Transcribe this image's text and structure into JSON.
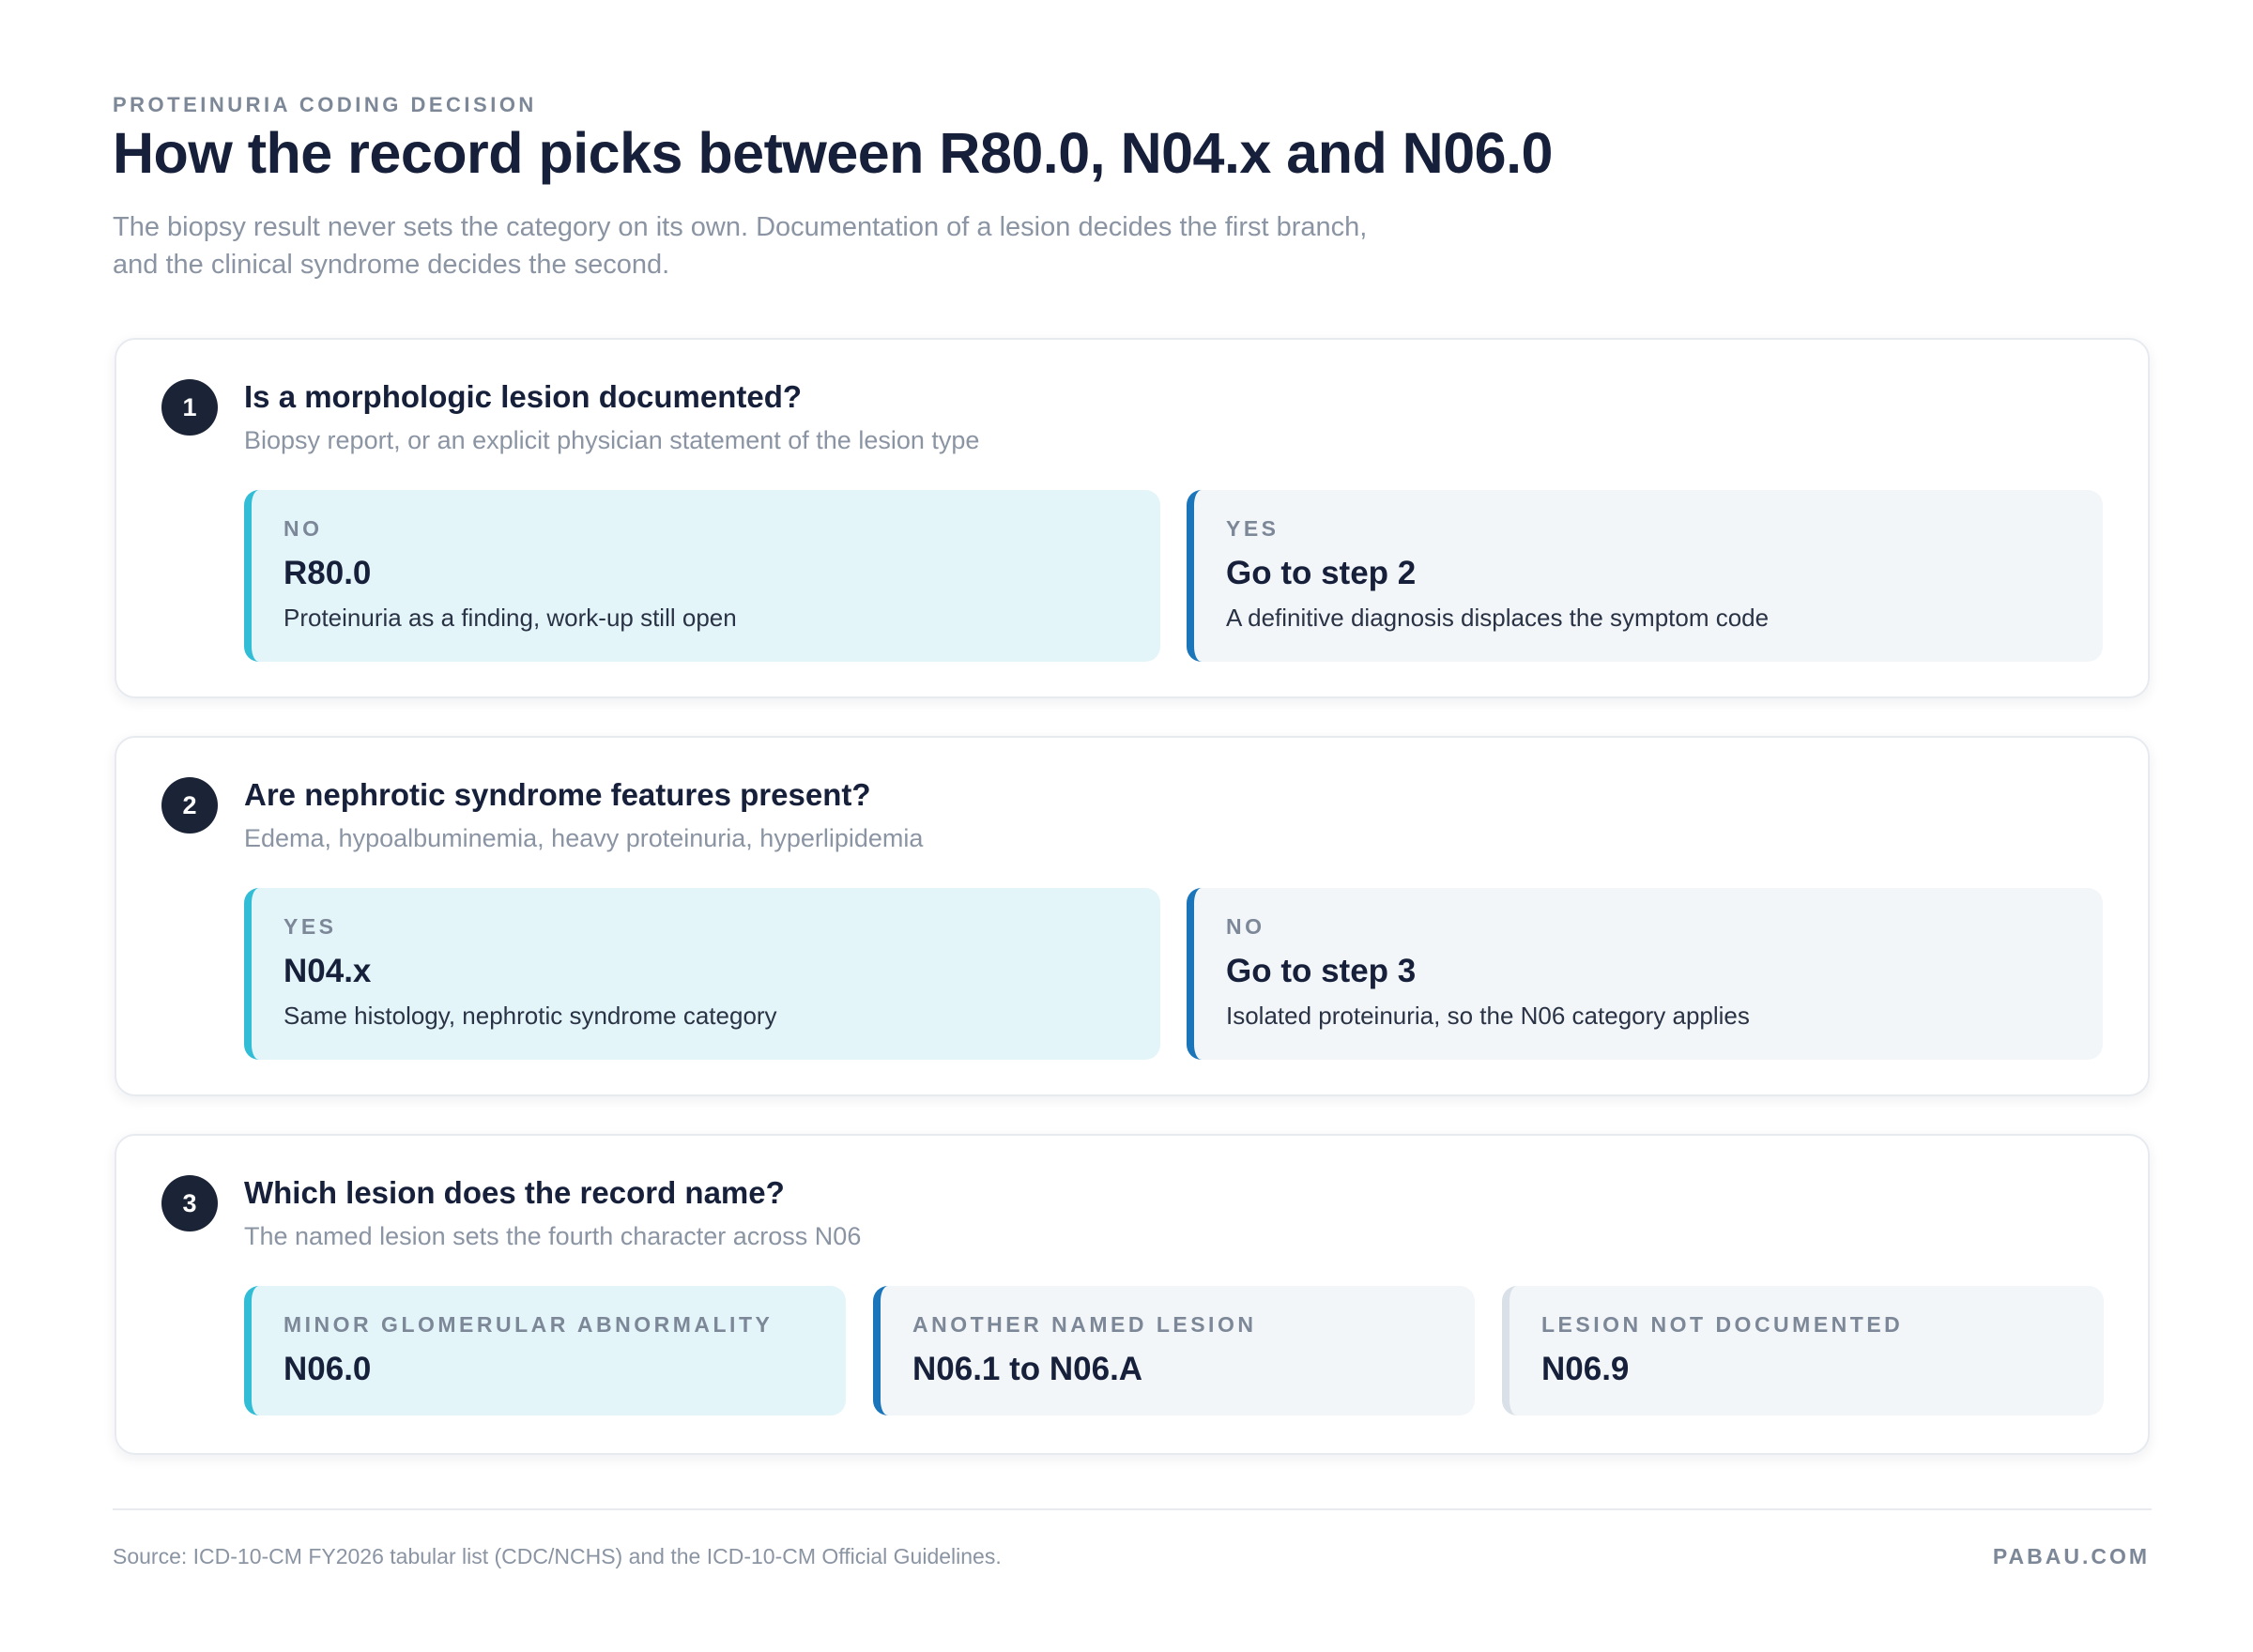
{
  "header": {
    "eyebrow": "PROTEINURIA CODING DECISION",
    "title": "How the record picks between R80.0, N04.x and N06.0",
    "subtitle_line1": "The biopsy result never sets the category on its own. Documentation of a lesion decides the first branch,",
    "subtitle_line2": "and the clinical syndrome decides the second."
  },
  "steps": [
    {
      "number": "1",
      "question": "Is a morphologic lesion documented?",
      "hint": "Biopsy report, or an explicit physician statement of the lesion type",
      "options": [
        {
          "label": "NO",
          "code": "R80.0",
          "desc": "Proteinuria as a finding, work-up still open"
        },
        {
          "label": "YES",
          "code": "Go to step 2",
          "desc": "A definitive diagnosis displaces the symptom code"
        }
      ]
    },
    {
      "number": "2",
      "question": "Are nephrotic syndrome features present?",
      "hint": "Edema, hypoalbuminemia, heavy proteinuria, hyperlipidemia",
      "options": [
        {
          "label": "YES",
          "code": "N04.x",
          "desc": "Same histology, nephrotic syndrome category"
        },
        {
          "label": "NO",
          "code": "Go to step 3",
          "desc": "Isolated proteinuria, so the N06 category applies"
        }
      ]
    },
    {
      "number": "3",
      "question": "Which lesion does the record name?",
      "hint": "The named lesion sets the fourth character across N06",
      "options": [
        {
          "label": "MINOR GLOMERULAR ABNORMALITY",
          "code": "N06.0"
        },
        {
          "label": "ANOTHER NAMED LESION",
          "code": "N06.1 to N06.A"
        },
        {
          "label": "LESION NOT DOCUMENTED",
          "code": "N06.9"
        }
      ]
    }
  ],
  "footer": {
    "source": "Source: ICD-10-CM FY2026 tabular list (CDC/NCHS) and the ICD-10-CM Official Guidelines.",
    "brand": "PABAU.COM"
  },
  "colors": {
    "accent_teal": "#32bdd6",
    "accent_blue": "#1a75bb",
    "accent_gray": "#d9e0e8",
    "teal_fill": "#e4f5fa",
    "gray_fill": "#f3f6f9",
    "navy": "#1b2437"
  }
}
